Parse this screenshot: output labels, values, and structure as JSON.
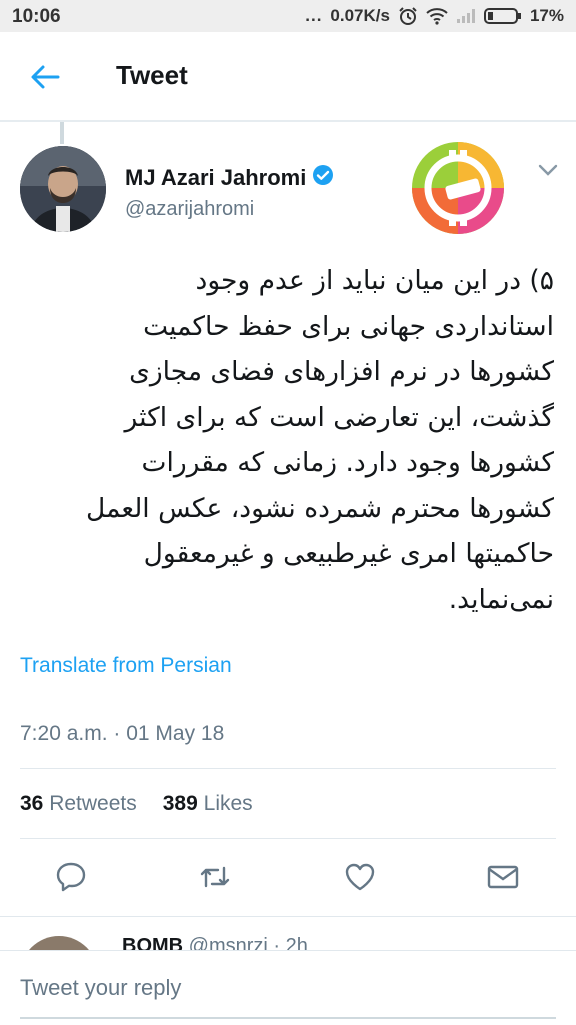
{
  "status_bar": {
    "time": "10:06",
    "dots": "...",
    "network_speed": "0.07K/s",
    "battery": "17%"
  },
  "header": {
    "title": "Tweet"
  },
  "tweet": {
    "author_name": "MJ Azari Jahromi",
    "handle": "@azarijahromi",
    "text": "۵) در این میان نباید از عدم وجود\nاستانداردی جهانی برای حفظ حاکمیت\nکشورها در نرم افزارهای فضای مجازی\nگذشت، این تعارضی است که برای اکثر\nکشورها وجود دارد. زمانی که  مقررات\nکشورها محترم شمرده نشود، عکس العمل\nحاکمیتها امری غیرطبیعی و غیرمعقول\nنمی‌نماید.",
    "translate_label": "Translate from Persian",
    "timestamp": "7:20 a.m. · 01 May 18",
    "retweets_count": "36",
    "retweets_label": "Retweets",
    "likes_count": "389",
    "likes_label": "Likes"
  },
  "next_reply": {
    "name": "BOMB",
    "meta": "@msnrzi · 2h"
  },
  "reply_bar": {
    "placeholder": "Tweet your reply"
  },
  "colors": {
    "accent": "#1da1f2",
    "muted": "#657786",
    "verified": "#1da1f2"
  }
}
